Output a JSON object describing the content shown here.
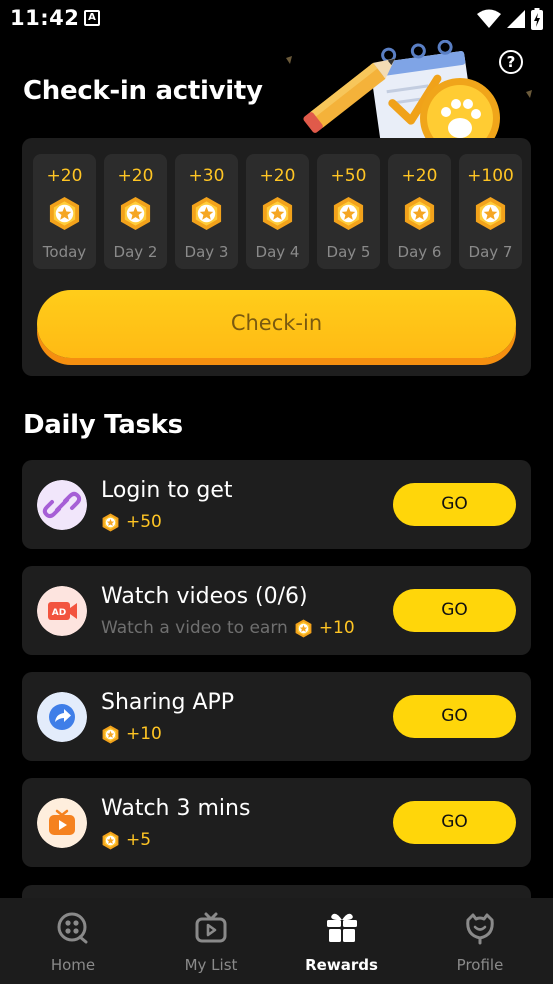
{
  "status_bar": {
    "time": "11:42",
    "notification_letter": "A"
  },
  "header": {
    "title": "Check-in activity",
    "help_symbol": "?"
  },
  "checkin": {
    "days": [
      {
        "points": "+20",
        "label": "Today"
      },
      {
        "points": "+20",
        "label": "Day 2"
      },
      {
        "points": "+30",
        "label": "Day 3"
      },
      {
        "points": "+20",
        "label": "Day 4"
      },
      {
        "points": "+50",
        "label": "Day 5"
      },
      {
        "points": "+20",
        "label": "Day 6"
      },
      {
        "points": "+100",
        "label": "Day 7"
      }
    ],
    "button_label": "Check-in"
  },
  "tasks": {
    "title": "Daily Tasks",
    "items": [
      {
        "title": "Login to get",
        "subtitle": "",
        "points": "+50",
        "action": "GO",
        "icon": "link-icon"
      },
      {
        "title": "Watch videos (0/6)",
        "subtitle": "Watch a video to earn",
        "points": "+10",
        "action": "GO",
        "icon": "ad-video-icon"
      },
      {
        "title": "Sharing APP",
        "subtitle": "",
        "points": "+10",
        "action": "GO",
        "icon": "share-icon"
      },
      {
        "title": "Watch 3 mins",
        "subtitle": "",
        "points": "+5",
        "action": "GO",
        "icon": "play-tv-icon"
      }
    ]
  },
  "nav": {
    "items": [
      {
        "label": "Home",
        "icon": "home-icon"
      },
      {
        "label": "My List",
        "icon": "tv-icon"
      },
      {
        "label": "Rewards",
        "icon": "gift-icon"
      },
      {
        "label": "Profile",
        "icon": "profile-icon"
      }
    ],
    "active": "Rewards"
  },
  "colors": {
    "accent": "#ffd60a",
    "coin": "#ffc524",
    "card": "#1e1e1e",
    "background": "#000000"
  }
}
